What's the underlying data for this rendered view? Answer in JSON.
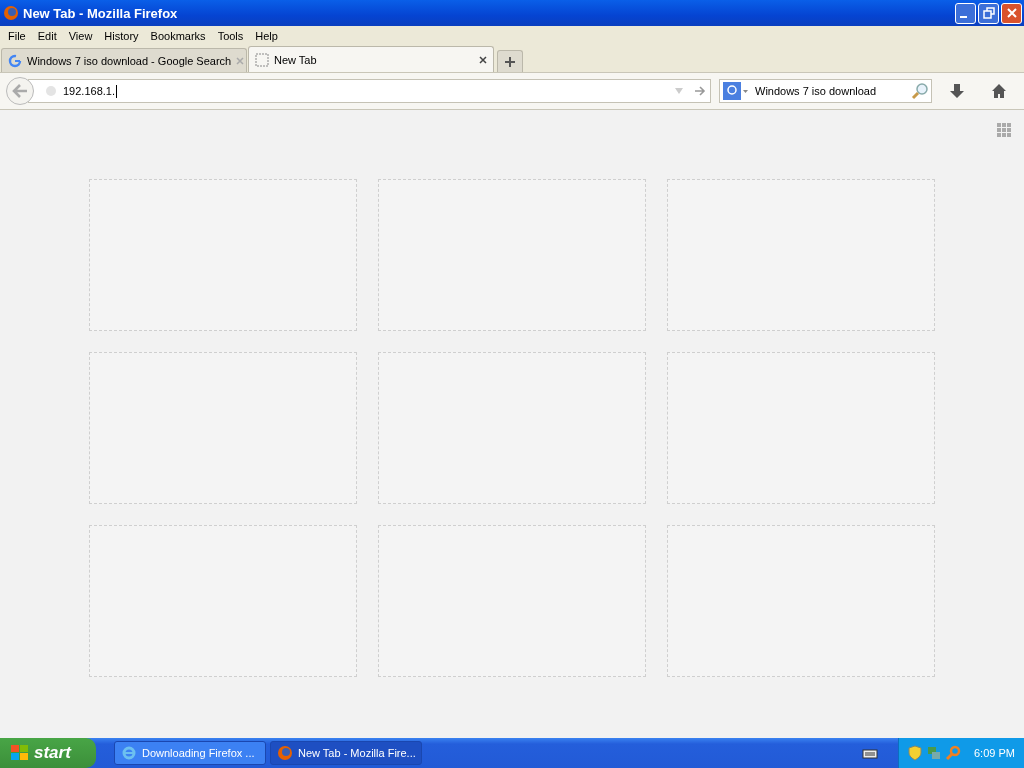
{
  "window": {
    "title": "New Tab - Mozilla Firefox"
  },
  "menu": [
    "File",
    "Edit",
    "View",
    "History",
    "Bookmarks",
    "Tools",
    "Help"
  ],
  "tabs": [
    {
      "label": "Windows 7 iso download - Google Search",
      "selected": false,
      "kind": "google"
    },
    {
      "label": "New Tab",
      "selected": true,
      "kind": "blank"
    }
  ],
  "address": {
    "value": "192.168.1."
  },
  "search": {
    "value": "Windows 7 iso download"
  },
  "tiles": [
    {
      "kind": "empty"
    },
    {
      "kind": "empty"
    },
    {
      "kind": "empty"
    },
    {
      "kind": "empty"
    },
    {
      "kind": "empty"
    },
    {
      "kind": "empty"
    },
    {
      "kind": "empty"
    },
    {
      "kind": "empty"
    },
    {
      "kind": "empty"
    }
  ],
  "taskbar": {
    "start": "start",
    "tasks": [
      {
        "label": "Downloading Firefox ...",
        "selected": false,
        "kind": "ie"
      },
      {
        "label": "New Tab - Mozilla Fire...",
        "selected": true,
        "kind": "firefox"
      }
    ],
    "clock": "6:09 PM"
  }
}
